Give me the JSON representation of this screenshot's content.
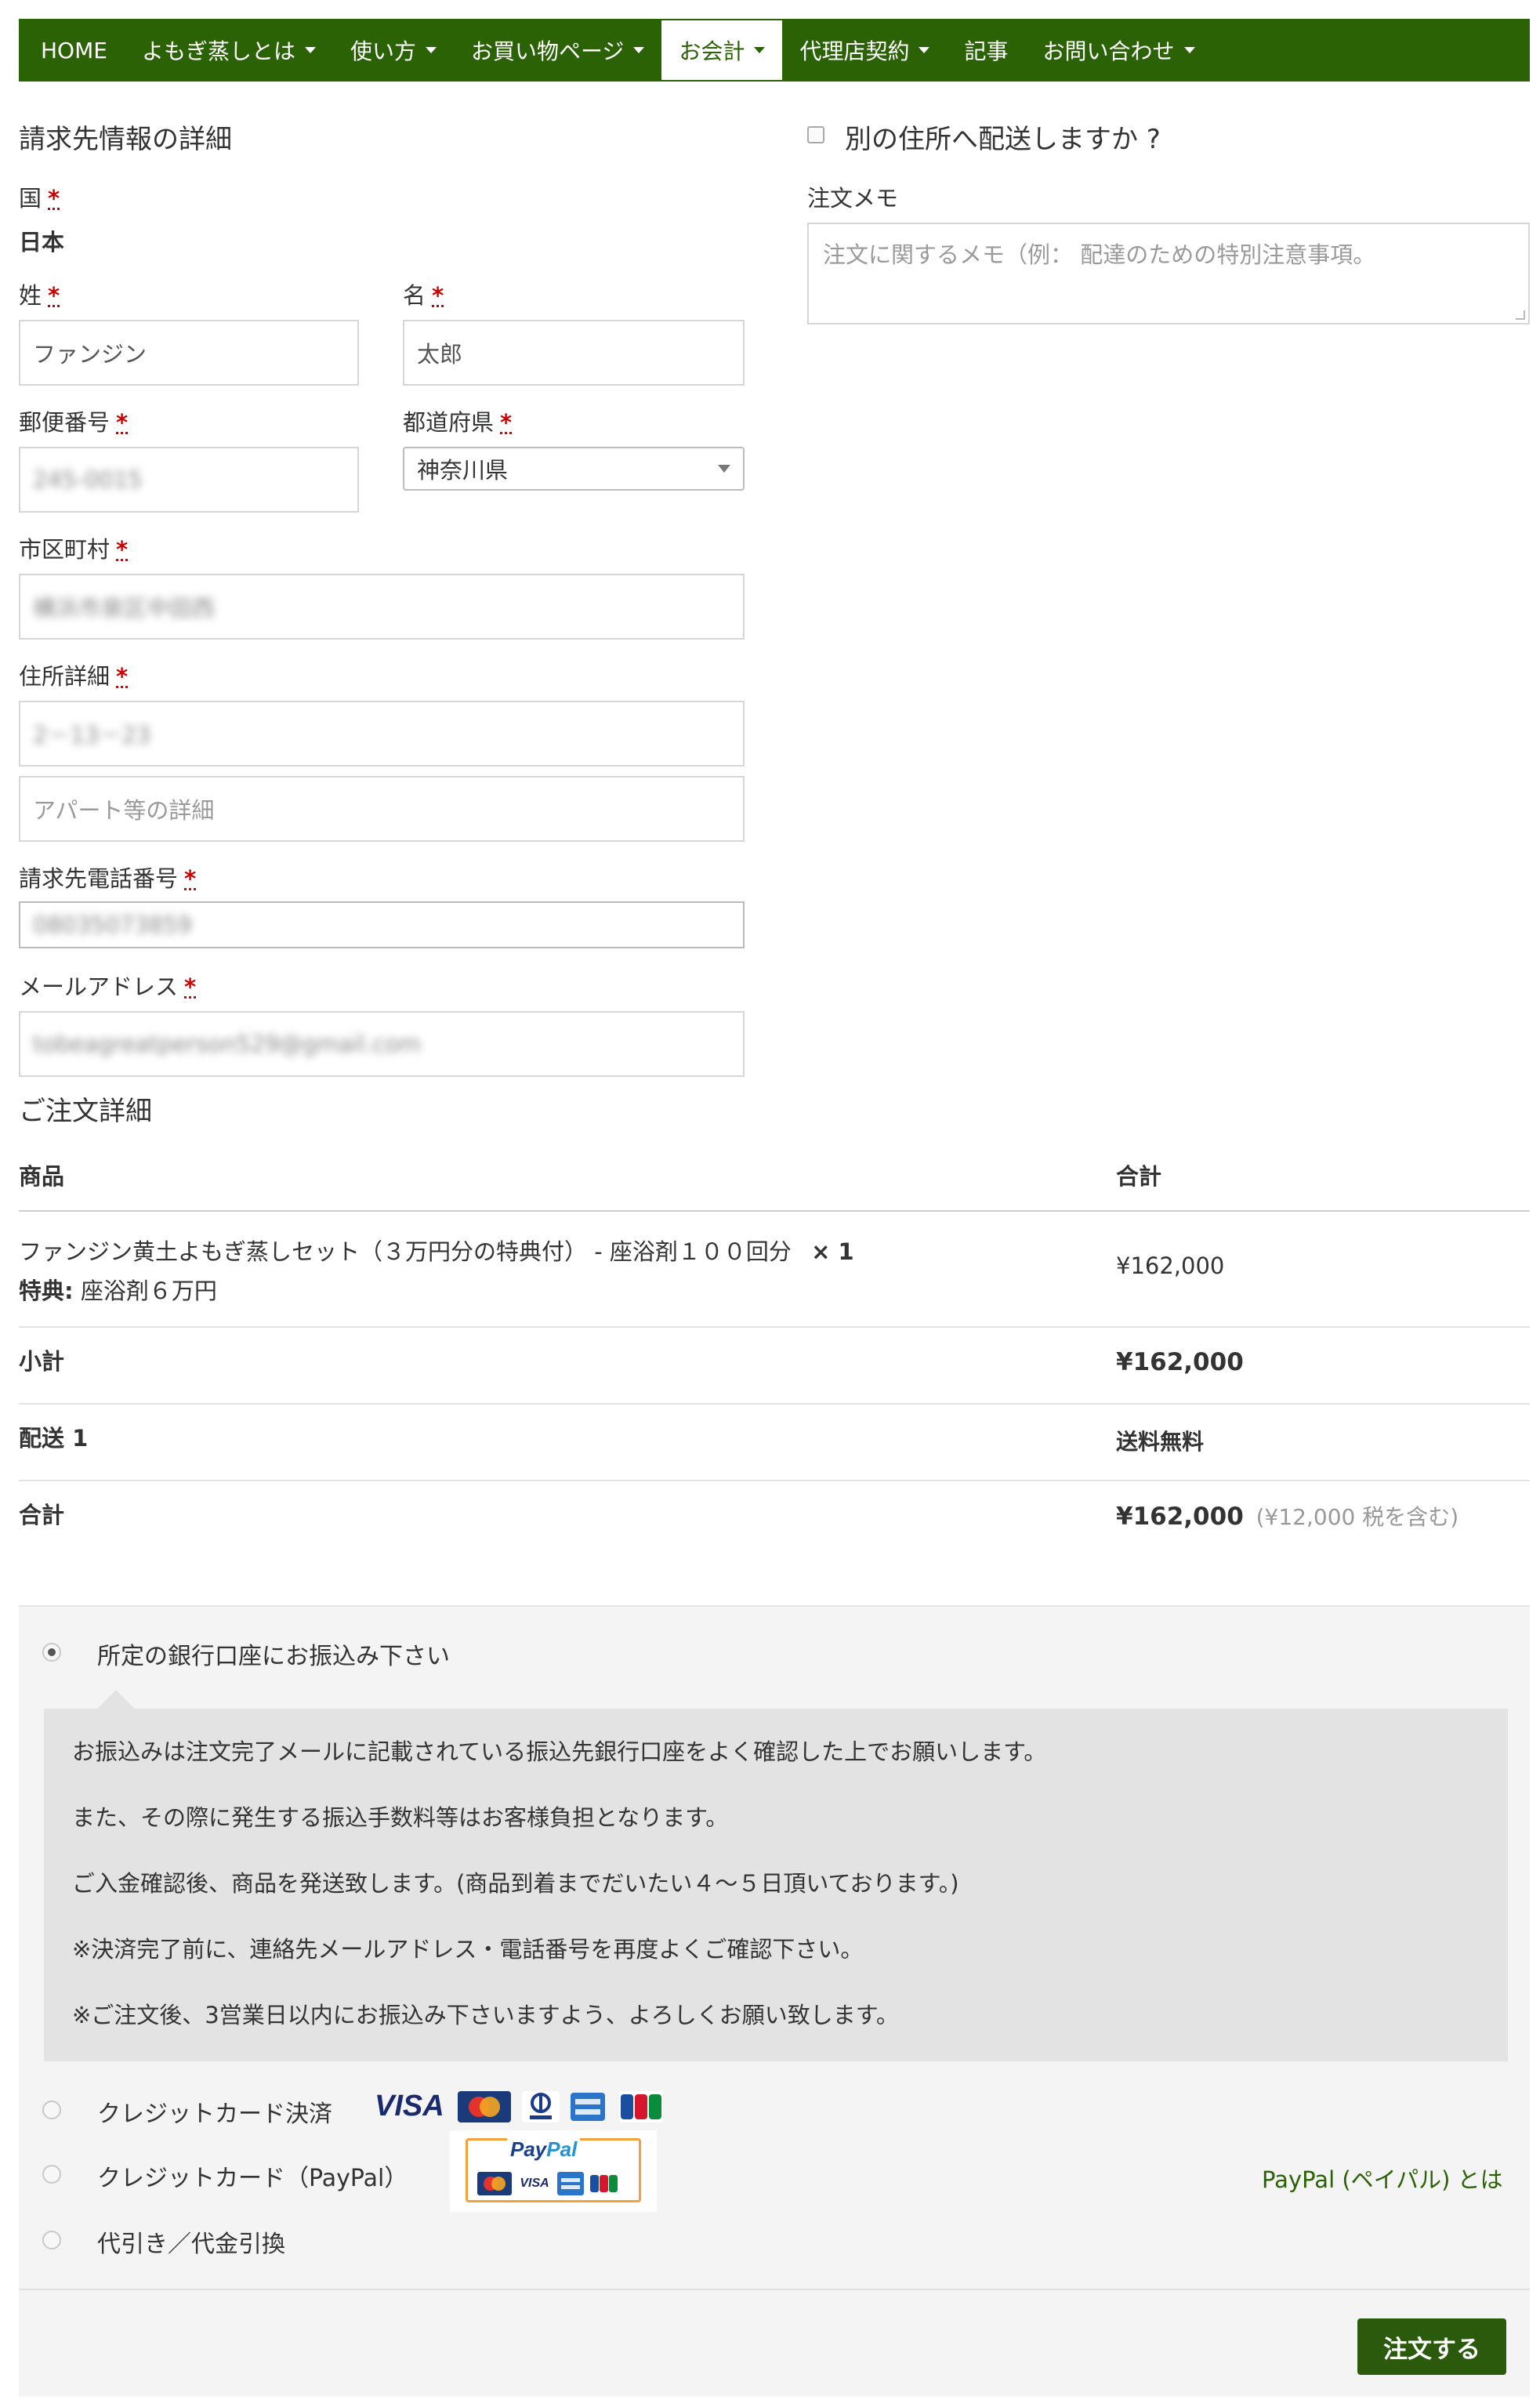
{
  "nav": {
    "items": [
      {
        "label": "HOME",
        "caret": false,
        "active": false
      },
      {
        "label": "よもぎ蒸しとは",
        "caret": true,
        "active": false
      },
      {
        "label": "使い方",
        "caret": true,
        "active": false
      },
      {
        "label": "お買い物ページ",
        "caret": true,
        "active": false
      },
      {
        "label": "お会計",
        "caret": true,
        "active": true
      },
      {
        "label": "代理店契約",
        "caret": true,
        "active": false
      },
      {
        "label": "記事",
        "caret": false,
        "active": false
      },
      {
        "label": "お問い合わせ",
        "caret": true,
        "active": false
      }
    ]
  },
  "billing": {
    "heading": "請求先情報の詳細",
    "required_mark": "*",
    "country_label": "国",
    "country_value": "日本",
    "last_name_label": "姓",
    "last_name_value": "ファンジン",
    "first_name_label": "名",
    "first_name_value": "太郎",
    "postcode_label": "郵便番号",
    "postcode_value": "245-0015",
    "prefecture_label": "都道府県",
    "prefecture_value": "神奈川県",
    "city_label": "市区町村",
    "city_value": "横浜市泉区中田西",
    "address_label": "住所詳細",
    "address_value": "2－13－23",
    "address2_placeholder": "アパート等の詳細",
    "phone_label": "請求先電話番号",
    "phone_value": "08035073859",
    "email_label": "メールアドレス",
    "email_value": "tobeagreatperson529@gmail.com"
  },
  "shipping": {
    "ship_different_label": "別の住所へ配送しますか ?",
    "notes_label": "注文メモ",
    "notes_placeholder": "注文に関するメモ（例： 配達のための特別注意事項。"
  },
  "order": {
    "heading": "ご注文詳細",
    "col_product": "商品",
    "col_total": "合計",
    "item_name": "ファンジン黄土よもぎ蒸しセット（３万円分の特典付） - 座浴剤１００回分",
    "item_qty": "× 1",
    "item_meta_label": "特典:",
    "item_meta_value": "座浴剤６万円",
    "item_total": "¥162,000",
    "subtotal_label": "小計",
    "subtotal_value": "¥162,000",
    "shipping_label": "配送 1",
    "shipping_value": "送料無料",
    "total_label": "合計",
    "total_value": "¥162,000",
    "total_tax_note": "(¥12,000 税を含む)"
  },
  "payment": {
    "bank_label": "所定の銀行口座にお振込み下さい",
    "bank_desc": [
      "お振込みは注文完了メールに記載されている振込先銀行口座をよく確認した上でお願いします。",
      "また、その際に発生する振込手数料等はお客様負担となります。",
      "ご入金確認後、商品を発送致します。(商品到着までだいたい４～５日頂いております。)",
      "※決済完了前に、連絡先メールアドレス・電話番号を再度よくご確認下さい。",
      "※ご注文後、3営業日以内にお振込み下さいますよう、よろしくお願い致します。"
    ],
    "credit_label": "クレジットカード決済",
    "paypal_label": "クレジットカード（PayPal）",
    "cod_label": "代引き／代金引換",
    "paypal_link": "PayPal (ペイパル) とは",
    "visa_text": "VISA",
    "paypal_word_1": "Pay",
    "paypal_word_2": "Pal",
    "submit_label": "注文する",
    "selected": "bank",
    "brand_color": "#2b6205"
  }
}
